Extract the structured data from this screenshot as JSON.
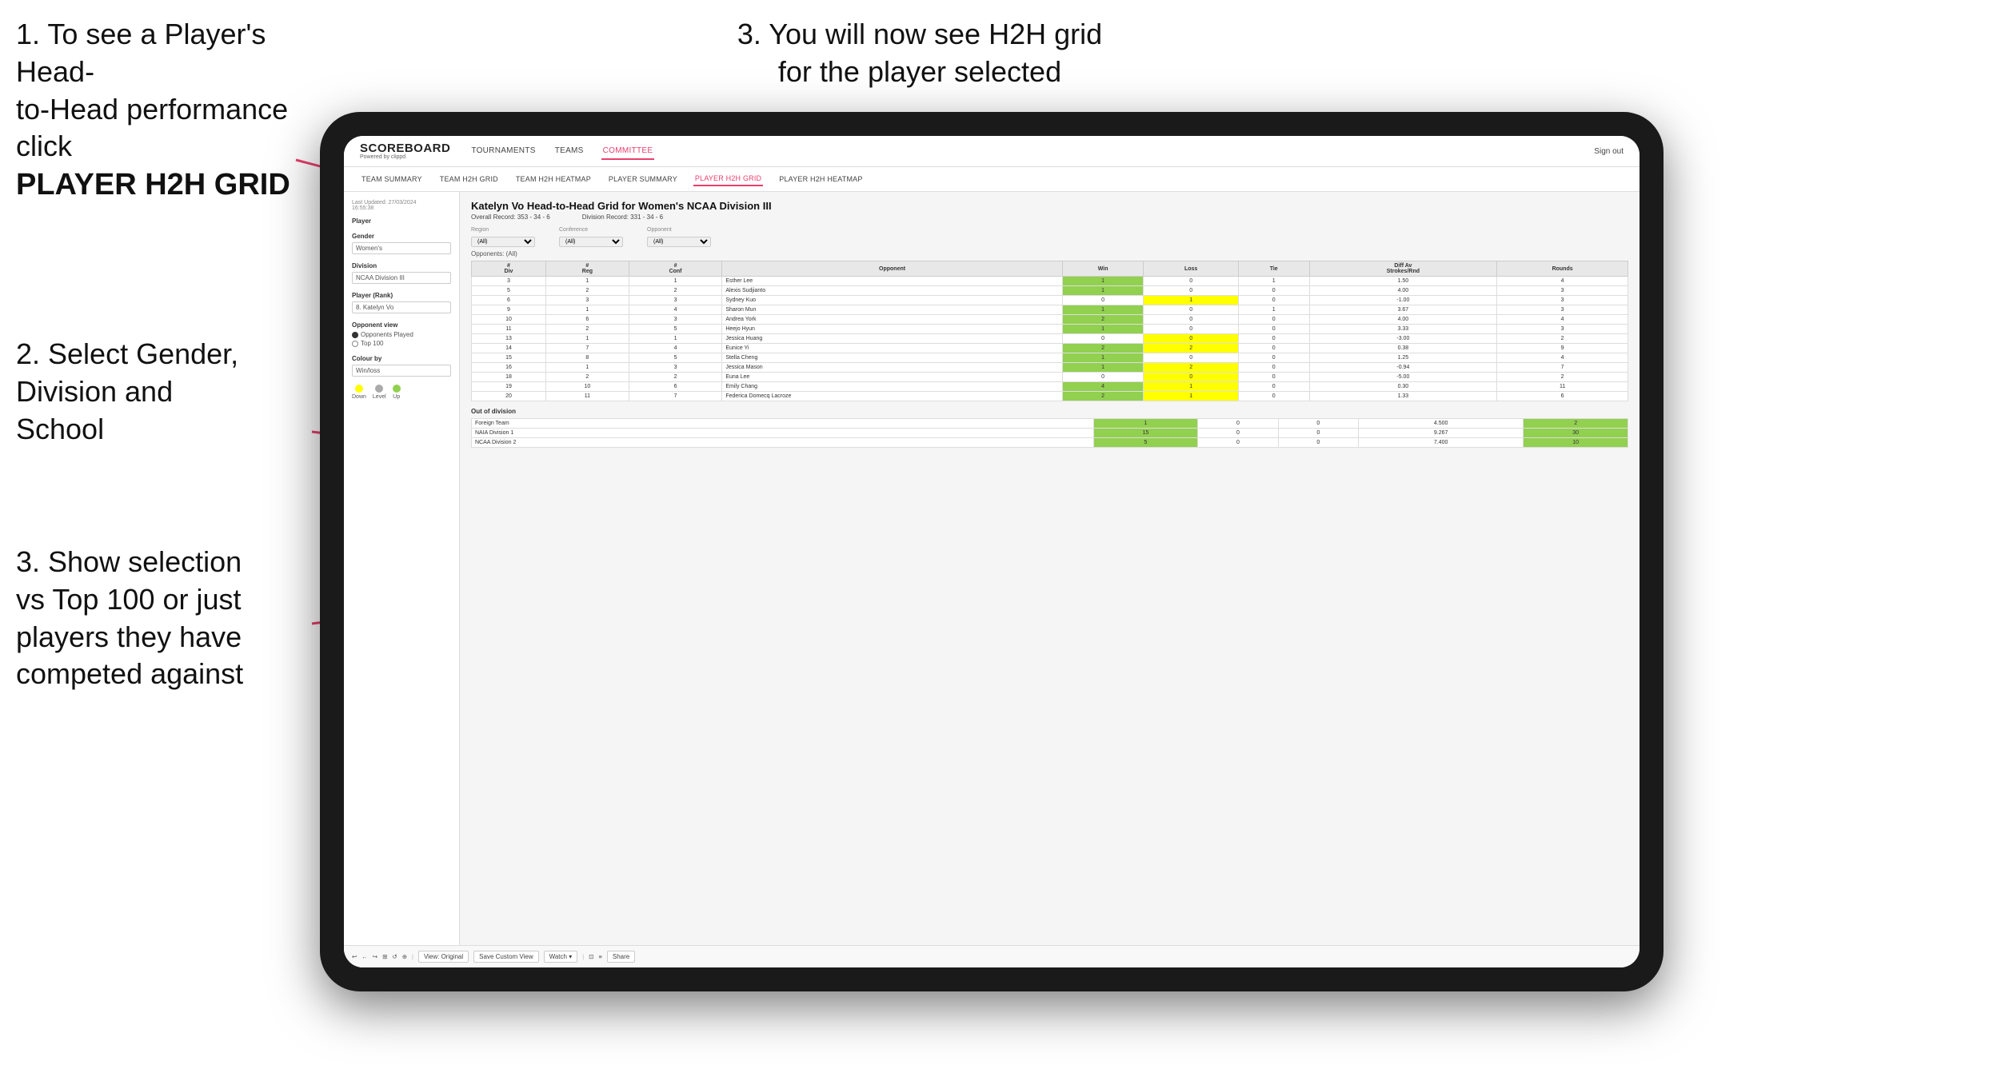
{
  "instructions": {
    "top_left_line1": "1. To see a Player's Head-",
    "top_left_line2": "to-Head performance click",
    "top_left_bold": "PLAYER H2H GRID",
    "top_right": "3. You will now see H2H grid\nfor the player selected",
    "middle_left_line1": "2. Select Gender,",
    "middle_left_line2": "Division and",
    "middle_left_line3": "School",
    "bottom_left_line1": "3. Show selection",
    "bottom_left_line2": "vs Top 100 or just",
    "bottom_left_line3": "players they have",
    "bottom_left_line4": "competed against"
  },
  "app": {
    "logo": "SCOREBOARD",
    "logo_sub": "Powered by clippd",
    "nav": [
      "TOURNAMENTS",
      "TEAMS",
      "COMMITTEE"
    ],
    "sign_out": "Sign out",
    "sub_nav": [
      "TEAM SUMMARY",
      "TEAM H2H GRID",
      "TEAM H2H HEATMAP",
      "PLAYER SUMMARY",
      "PLAYER H2H GRID",
      "PLAYER H2H HEATMAP"
    ]
  },
  "sidebar": {
    "timestamp": "Last Updated: 27/03/2024\n16:55:38",
    "player_label": "Player",
    "gender_label": "Gender",
    "gender_value": "Women's",
    "division_label": "Division",
    "division_value": "NCAA Division III",
    "player_rank_label": "Player (Rank)",
    "player_rank_value": "8. Katelyn Vo",
    "opponent_view_label": "Opponent view",
    "radio1": "Opponents Played",
    "radio2": "Top 100",
    "colour_by_label": "Colour by",
    "colour_by_value": "Win/loss",
    "legend": [
      {
        "label": "Down",
        "color": "#ffff00"
      },
      {
        "label": "Level",
        "color": "#aaaaaa"
      },
      {
        "label": "Up",
        "color": "#92d050"
      }
    ]
  },
  "data": {
    "title": "Katelyn Vo Head-to-Head Grid for Women's NCAA Division III",
    "overall_record": "Overall Record: 353 - 34 - 6",
    "division_record": "Division Record: 331 - 34 - 6",
    "region_label": "Region",
    "conference_label": "Conference",
    "opponent_label": "Opponent",
    "opponents_label": "Opponents:",
    "filter_all": "(All)",
    "columns": [
      "# Div",
      "# Reg",
      "# Conf",
      "Opponent",
      "Win",
      "Loss",
      "Tie",
      "Diff Av Strokes/Rnd",
      "Rounds"
    ],
    "rows": [
      {
        "div": "3",
        "reg": "1",
        "conf": "1",
        "opponent": "Esther Lee",
        "win": "1",
        "loss": "0",
        "tie": "1",
        "diff": "1.50",
        "rounds": "4",
        "win_color": "green",
        "loss_color": "",
        "tie_color": ""
      },
      {
        "div": "5",
        "reg": "2",
        "conf": "2",
        "opponent": "Alexis Sudjianto",
        "win": "1",
        "loss": "0",
        "tie": "0",
        "diff": "4.00",
        "rounds": "3",
        "win_color": "green",
        "loss_color": "",
        "tie_color": ""
      },
      {
        "div": "6",
        "reg": "3",
        "conf": "3",
        "opponent": "Sydney Kuo",
        "win": "0",
        "loss": "1",
        "tie": "0",
        "diff": "-1.00",
        "rounds": "3",
        "win_color": "",
        "loss_color": "yellow",
        "tie_color": ""
      },
      {
        "div": "9",
        "reg": "1",
        "conf": "4",
        "opponent": "Sharon Mun",
        "win": "1",
        "loss": "0",
        "tie": "1",
        "diff": "3.67",
        "rounds": "3",
        "win_color": "green",
        "loss_color": "",
        "tie_color": ""
      },
      {
        "div": "10",
        "reg": "6",
        "conf": "3",
        "opponent": "Andrea York",
        "win": "2",
        "loss": "0",
        "tie": "0",
        "diff": "4.00",
        "rounds": "4",
        "win_color": "green",
        "loss_color": "",
        "tie_color": ""
      },
      {
        "div": "11",
        "reg": "2",
        "conf": "5",
        "opponent": "Heejo Hyun",
        "win": "1",
        "loss": "0",
        "tie": "0",
        "diff": "3.33",
        "rounds": "3",
        "win_color": "green",
        "loss_color": "",
        "tie_color": ""
      },
      {
        "div": "13",
        "reg": "1",
        "conf": "1",
        "opponent": "Jessica Huang",
        "win": "0",
        "loss": "0",
        "tie": "0",
        "diff": "-3.00",
        "rounds": "2",
        "win_color": "",
        "loss_color": "yellow",
        "tie_color": ""
      },
      {
        "div": "14",
        "reg": "7",
        "conf": "4",
        "opponent": "Eunice Yi",
        "win": "2",
        "loss": "2",
        "tie": "0",
        "diff": "0.38",
        "rounds": "9",
        "win_color": "green",
        "loss_color": "yellow",
        "tie_color": ""
      },
      {
        "div": "15",
        "reg": "8",
        "conf": "5",
        "opponent": "Stella Cheng",
        "win": "1",
        "loss": "0",
        "tie": "0",
        "diff": "1.25",
        "rounds": "4",
        "win_color": "green",
        "loss_color": "",
        "tie_color": ""
      },
      {
        "div": "16",
        "reg": "1",
        "conf": "3",
        "opponent": "Jessica Mason",
        "win": "1",
        "loss": "2",
        "tie": "0",
        "diff": "-0.94",
        "rounds": "7",
        "win_color": "green",
        "loss_color": "yellow",
        "tie_color": ""
      },
      {
        "div": "18",
        "reg": "2",
        "conf": "2",
        "opponent": "Euna Lee",
        "win": "0",
        "loss": "0",
        "tie": "0",
        "diff": "-5.00",
        "rounds": "2",
        "win_color": "",
        "loss_color": "yellow",
        "tie_color": ""
      },
      {
        "div": "19",
        "reg": "10",
        "conf": "6",
        "opponent": "Emily Chang",
        "win": "4",
        "loss": "1",
        "tie": "0",
        "diff": "0.30",
        "rounds": "11",
        "win_color": "green",
        "loss_color": "yellow",
        "tie_color": ""
      },
      {
        "div": "20",
        "reg": "11",
        "conf": "7",
        "opponent": "Federica Domecq Lacroze",
        "win": "2",
        "loss": "1",
        "tie": "0",
        "diff": "1.33",
        "rounds": "6",
        "win_color": "green",
        "loss_color": "yellow",
        "tie_color": ""
      }
    ],
    "out_of_division_label": "Out of division",
    "out_of_division_rows": [
      {
        "label": "Foreign Team",
        "win": "1",
        "loss": "0",
        "tie": "0",
        "diff": "4.500",
        "rounds": "2"
      },
      {
        "label": "NAIA Division 1",
        "win": "15",
        "loss": "0",
        "tie": "0",
        "diff": "9.267",
        "rounds": "30"
      },
      {
        "label": "NCAA Division 2",
        "win": "5",
        "loss": "0",
        "tie": "0",
        "diff": "7.400",
        "rounds": "10"
      }
    ]
  },
  "toolbar": {
    "buttons": [
      "↩",
      "←",
      "↪",
      "⊞",
      "↺",
      "⊕",
      "View: Original",
      "Save Custom View",
      "Watch ▾",
      "⊡",
      "≡",
      "Share"
    ]
  }
}
